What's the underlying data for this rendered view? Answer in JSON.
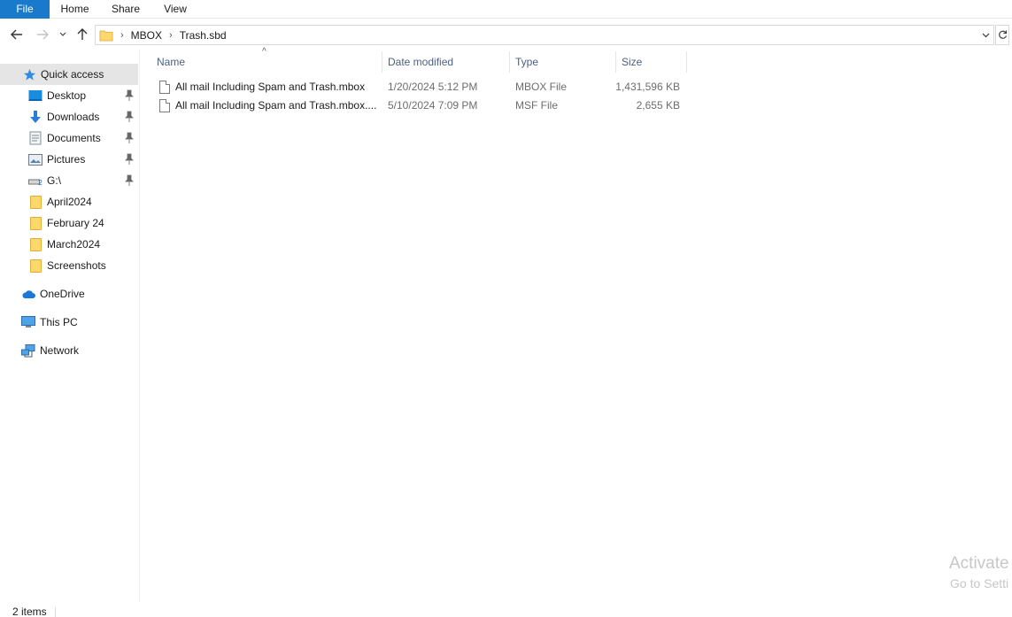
{
  "ribbon": {
    "tabs": [
      "File",
      "Home",
      "Share",
      "View"
    ]
  },
  "address": {
    "crumbs": [
      "MBOX",
      "Trash.sbd"
    ]
  },
  "nav": {
    "items": [
      {
        "label": "Quick access",
        "icon": "star-icon"
      },
      {
        "label": "Desktop",
        "icon": "desktop-icon",
        "pinned": true
      },
      {
        "label": "Downloads",
        "icon": "download-icon",
        "pinned": true
      },
      {
        "label": "Documents",
        "icon": "documents-icon",
        "pinned": true
      },
      {
        "label": "Pictures",
        "icon": "pictures-icon",
        "pinned": true
      },
      {
        "label": "G:\\",
        "icon": "drive-icon",
        "pinned": true
      },
      {
        "label": "April2024",
        "icon": "folder-icon"
      },
      {
        "label": "February 24",
        "icon": "folder-icon"
      },
      {
        "label": "March2024",
        "icon": "folder-icon"
      },
      {
        "label": "Screenshots",
        "icon": "folder-icon"
      },
      {
        "label": "OneDrive",
        "icon": "cloud-icon"
      },
      {
        "label": "This PC",
        "icon": "computer-icon"
      },
      {
        "label": "Network",
        "icon": "network-icon"
      }
    ]
  },
  "columns": {
    "name": "Name",
    "date": "Date modified",
    "type": "Type",
    "size": "Size"
  },
  "files": [
    {
      "name": "All mail Including Spam and Trash.mbox",
      "date": "1/20/2024 5:12 PM",
      "type": "MBOX File",
      "size": "1,431,596 KB"
    },
    {
      "name": "All mail Including Spam and Trash.mbox....",
      "date": "5/10/2024 7:09 PM",
      "type": "MSF File",
      "size": "2,655 KB"
    }
  ],
  "status": {
    "count": "2 items"
  },
  "watermark": {
    "line1": "Activate",
    "line2": "Go to Setti"
  },
  "colors": {
    "accent": "#1979ca",
    "folder": "#ffd86b"
  }
}
